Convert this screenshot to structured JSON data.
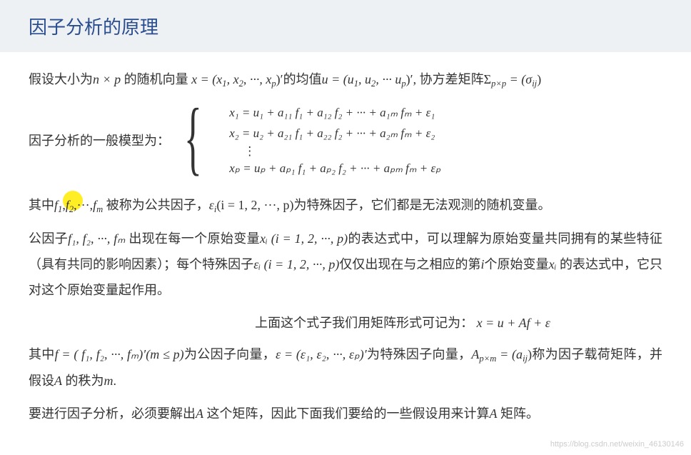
{
  "header": {
    "title": "因子分析的原理"
  },
  "p1": {
    "t1": "假设大小为",
    "size": "n × p",
    "t2": " 的随机向量 ",
    "x": "x = (x",
    "xs1": "1",
    "c": ", x",
    "xs2": "2",
    "dots": ", ···, x",
    "xsp": "p",
    "xe": ")′",
    "t3": "的均值",
    "u": "u = (u",
    "us1": "1",
    "uc": ", u",
    "us2": "2",
    "udots": ", ··· u",
    "usp": "p",
    "ue": ")′, ",
    "t4": "协方差矩阵",
    "sig": "Σ",
    "sigsub": "p×p",
    "sige": " = (σ",
    "sigij": "ij",
    "sigc": ")"
  },
  "model": {
    "label": "因子分析的一般模型为：",
    "eq1": "x₁ = u₁ + a₁₁ f₁ + a₁₂ f₂ + ··· + a₁ₘ fₘ + ε₁",
    "eq2": "x₂ = u₂ + a₂₁ f₁ + a₂₂ f₂ + ··· + a₂ₘ fₘ + ε₂",
    "vdots": "⋮",
    "eqp": "xₚ = uₚ + aₚ₁ f₁ + aₚ₂ f₂ + ··· + aₚₘ fₘ + εₚ"
  },
  "p2": {
    "t1": "其中",
    "f1": "f",
    "fs1": "1",
    "cm": ",",
    "f2": "f",
    "fs2": "2",
    "fdots": ",···,",
    "fm": "f",
    "fsm": "m",
    "t2": " 被称为公共因子，",
    "eps": "ε",
    "epsi": "i",
    "rng": "(i = 1, 2, ···, p)",
    "t3": "为特殊因子，它们都是无法观测的随机变量。"
  },
  "p3": {
    "t1": "公因子",
    "fl": "f₁, f₂, ···, fₘ",
    "t2": " 出现在每一个原始变量",
    "xi": "xᵢ (i = 1, 2, ···, p)",
    "t3": "的表达式中，可以理解为原始变量共同拥有的某些特征（具有共同的影响因素）；每个特殊因子",
    "eps": "εᵢ (i = 1, 2, ···, p)",
    "t4": "仅仅出现在与之相应的第",
    "ii": "i",
    "t5": "个原始变量",
    "xi2": "xᵢ",
    "t6": " 的表达式中，它只对这个原始变量起作用。"
  },
  "p4": {
    "t1": "上面这个式子我们用矩阵形式可记为：",
    "eq": "x = u + Af + ε"
  },
  "p5": {
    "t1": "其中",
    "f": "f = ( f₁, f₂, ···, fₘ)′(m ≤ p)",
    "t2": "为公因子向量，",
    "eps": "ε = (ε₁, ε₂, ···, εₚ)′",
    "t3": "为特殊因子向量，",
    "A": "A",
    "Asub": "p×m",
    "Aeq": " = (a",
    "Aij": "ij",
    "Ac": ")",
    "t4": "称为因子载荷矩阵，并假设",
    "A2": "A",
    "t5": " 的秩为",
    "m": "m",
    "t6": "."
  },
  "p6": {
    "t1": "要进行因子分析，必须要解出",
    "A": "A",
    "t2": " 这个矩阵，因此下面我们要给的一些假设用来计算",
    "A2": "A",
    "t3": " 矩阵。"
  },
  "watermark": "https://blog.csdn.net/weixin_46130146"
}
